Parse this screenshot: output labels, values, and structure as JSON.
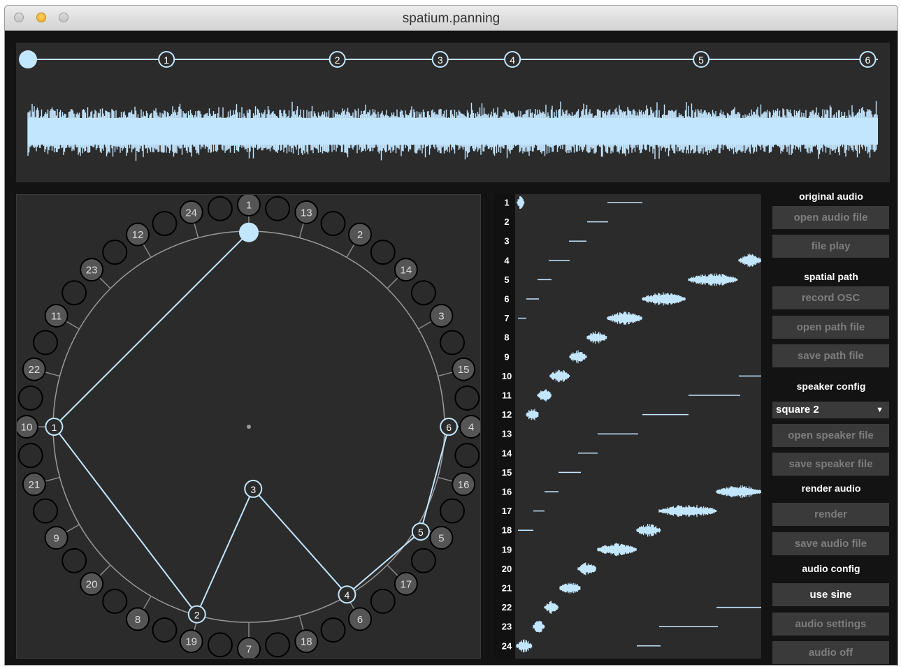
{
  "window": {
    "title": "spatium.panning"
  },
  "colors": {
    "accent": "#c3e6ff",
    "panel": "#2b2b2b",
    "background": "#131313",
    "button": "#3a3a3a",
    "button_text_disabled": "#7d7d7d"
  },
  "timeline": {
    "markers": [
      {
        "label": "",
        "pos": 0.0
      },
      {
        "label": "1",
        "pos": 0.163
      },
      {
        "label": "2",
        "pos": 0.364
      },
      {
        "label": "3",
        "pos": 0.485
      },
      {
        "label": "4",
        "pos": 0.57
      },
      {
        "label": "5",
        "pos": 0.792
      },
      {
        "label": "6",
        "pos": 0.988
      }
    ]
  },
  "speakers": {
    "outer_labeled": [
      {
        "label": "1",
        "angle": 0
      },
      {
        "label": "13",
        "angle": 15
      },
      {
        "label": "2",
        "angle": 30
      },
      {
        "label": "14",
        "angle": 45
      },
      {
        "label": "3",
        "angle": 60
      },
      {
        "label": "15",
        "angle": 75
      },
      {
        "label": "4",
        "angle": 90
      },
      {
        "label": "16",
        "angle": 105
      },
      {
        "label": "5",
        "angle": 120
      },
      {
        "label": "17",
        "angle": 135
      },
      {
        "label": "6",
        "angle": 150
      },
      {
        "label": "18",
        "angle": 165
      },
      {
        "label": "7",
        "angle": 180
      },
      {
        "label": "19",
        "angle": 195
      },
      {
        "label": "8",
        "angle": 210
      },
      {
        "label": "20",
        "angle": 225
      },
      {
        "label": "9",
        "angle": 240
      },
      {
        "label": "21",
        "angle": 255
      },
      {
        "label": "10",
        "angle": 270
      },
      {
        "label": "22",
        "angle": 285
      },
      {
        "label": "11",
        "angle": 300
      },
      {
        "label": "23",
        "angle": 315
      },
      {
        "label": "12",
        "angle": 330
      },
      {
        "label": "24",
        "angle": 345
      }
    ]
  },
  "path_points": [
    {
      "label": "",
      "x": 0.0,
      "y": 0.892
    },
    {
      "label": "1",
      "x": -0.893,
      "y": 0.0
    },
    {
      "label": "2",
      "x": -0.238,
      "y": -0.861
    },
    {
      "label": "3",
      "x": 0.02,
      "y": -0.285
    },
    {
      "label": "4",
      "x": 0.45,
      "y": -0.77
    },
    {
      "label": "5",
      "x": 0.788,
      "y": -0.481
    },
    {
      "label": "6",
      "x": 0.917,
      "y": 0.0
    }
  ],
  "tracks": {
    "labels": [
      "1",
      "2",
      "3",
      "4",
      "5",
      "6",
      "7",
      "8",
      "9",
      "10",
      "11",
      "12",
      "13",
      "14",
      "15",
      "16",
      "17",
      "18",
      "19",
      "20",
      "21",
      "22",
      "23",
      "24"
    ]
  },
  "controls": {
    "original_audio_title": "original audio",
    "open_audio_file": "open audio file",
    "file_play": "file play",
    "spatial_path_title": "spatial path",
    "record_osc": "record OSC",
    "open_path_file": "open path file",
    "save_path_file": "save path file",
    "speaker_config_title": "speaker config",
    "speaker_config_value": "square 2",
    "open_speaker_file": "open speaker file",
    "save_speaker_file": "save speaker file",
    "render_audio_title": "render audio",
    "render": "render",
    "save_audio_file": "save audio file",
    "audio_config_title": "audio config",
    "use_sine": "use sine",
    "audio_settings": "audio settings",
    "audio_off": "audio off"
  }
}
